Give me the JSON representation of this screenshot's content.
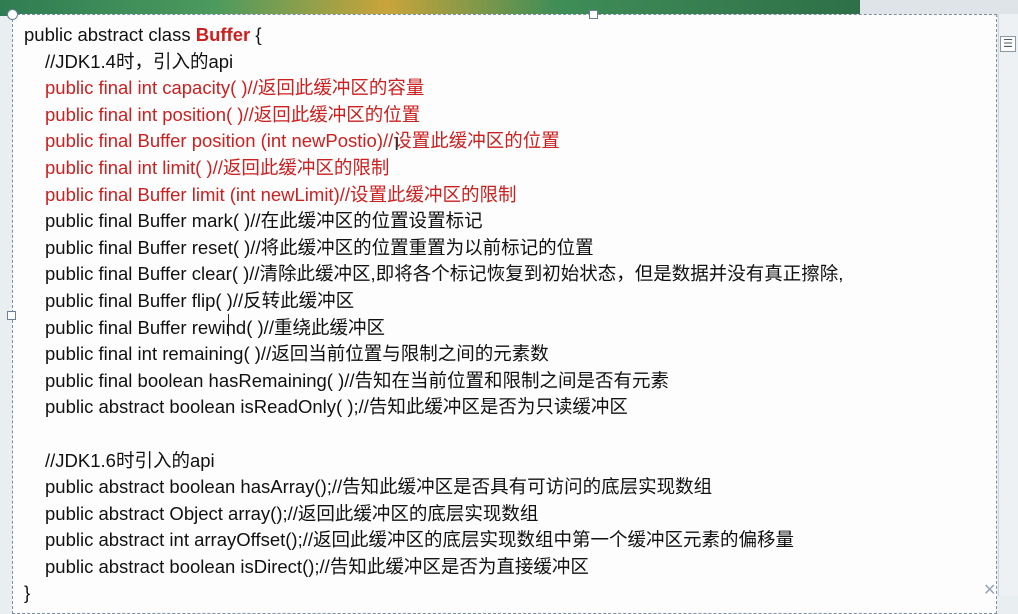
{
  "class_decl": {
    "prefix": "public abstract class ",
    "name": "Buffer",
    "brace": " {"
  },
  "sections": [
    {
      "comment": "//JDK1.4时，引入的api",
      "lines": [
        {
          "text": "public final int capacity( )//返回此缓冲区的容量",
          "red": true
        },
        {
          "text": "public final int position( )//返回此缓冲区的位置",
          "red": true
        },
        {
          "text": "public final Buffer position (int newPostio)//设置此缓冲区的位置",
          "red": true
        },
        {
          "text": "public final int limit( )//返回此缓冲区的限制",
          "red": true
        },
        {
          "text": "public final Buffer limit (int newLimit)//设置此缓冲区的限制",
          "red": true
        },
        {
          "text": "public final Buffer mark( )//在此缓冲区的位置设置标记",
          "red": false
        },
        {
          "text": "public final Buffer reset( )//将此缓冲区的位置重置为以前标记的位置",
          "red": false
        },
        {
          "text": "public final Buffer clear( )//清除此缓冲区,即将各个标记恢复到初始状态，但是数据并没有真正擦除,",
          "red": false
        },
        {
          "text": "public final Buffer flip( )//反转此缓冲区",
          "red": false
        },
        {
          "text": "public final Buffer rewind( )//重绕此缓冲区",
          "red": false
        },
        {
          "text": "public final int remaining( )//返回当前位置与限制之间的元素数",
          "red": false
        },
        {
          "text": "public final boolean hasRemaining( )//告知在当前位置和限制之间是否有元素",
          "red": false
        },
        {
          "text": "public abstract boolean isReadOnly( );//告知此缓冲区是否为只读缓冲区",
          "red": false
        }
      ]
    },
    {
      "comment": "//JDK1.6时引入的api",
      "lines": [
        {
          "text": "public abstract boolean hasArray();//告知此缓冲区是否具有可访问的底层实现数组",
          "red": false
        },
        {
          "text": "public abstract Object array();//返回此缓冲区的底层实现数组",
          "red": false
        },
        {
          "text": "public abstract int arrayOffset();//返回此缓冲区的底层实现数组中第一个缓冲区元素的偏移量",
          "red": false
        },
        {
          "text": "public abstract boolean isDirect();//告知此缓冲区是否为直接缓冲区",
          "red": false
        }
      ]
    }
  ],
  "closing": "}",
  "icons": {
    "panel": "layout-options-icon",
    "close": "close-icon"
  },
  "colors": {
    "highlight": "#cc1f1f",
    "text": "#111111"
  }
}
